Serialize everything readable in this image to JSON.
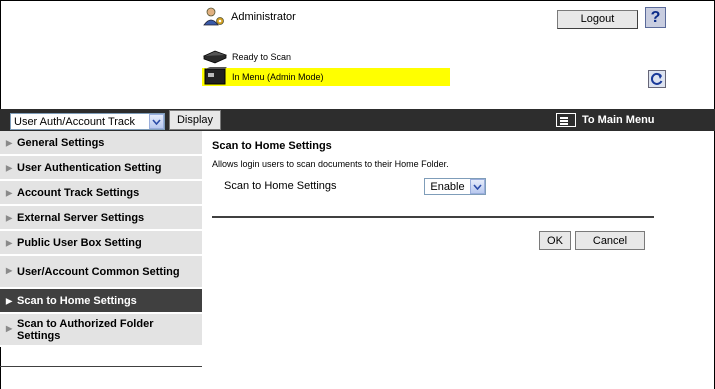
{
  "header": {
    "user_label": "Administrator",
    "logout_label": "Logout",
    "help_label": "?",
    "status_ready": "Ready to Scan",
    "status_menu": "In Menu (Admin Mode)"
  },
  "toolbar": {
    "selector_value": "User Auth/Account Track",
    "display_label": "Display",
    "to_main_label": "To Main Menu"
  },
  "sidebar": {
    "items": [
      {
        "label": "General Settings"
      },
      {
        "label": "User Authentication Setting"
      },
      {
        "label": "Account Track Settings"
      },
      {
        "label": "External Server Settings"
      },
      {
        "label": "Public User Box Setting"
      },
      {
        "label": "User/Account Common Setting"
      },
      {
        "label": "Scan to Home Settings"
      },
      {
        "label": "Scan to Authorized Folder Settings"
      }
    ],
    "active_index": 6
  },
  "main": {
    "title": "Scan to Home Settings",
    "description": "Allows login users to scan documents to their Home Folder.",
    "setting_label": "Scan to Home Settings",
    "setting_value": "Enable",
    "ok_label": "OK",
    "cancel_label": "Cancel"
  },
  "colors": {
    "toolbar_bg": "#2d2d2d",
    "status_highlight": "#ffff00",
    "sidebar_bg": "#e3e3e3",
    "sidebar_active_bg": "#404040"
  }
}
